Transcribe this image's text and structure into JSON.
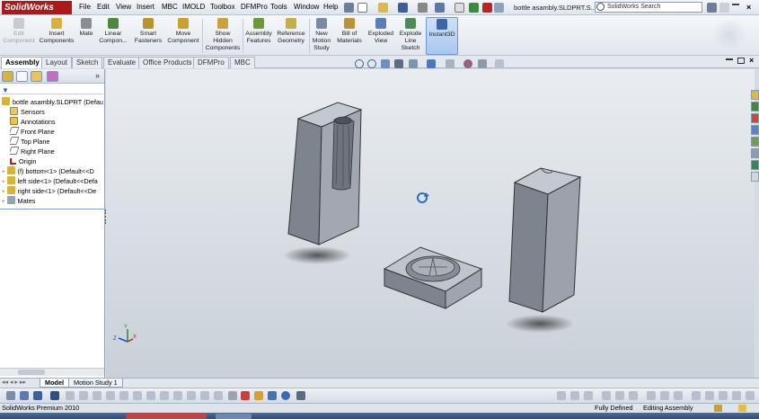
{
  "app": {
    "logo_text": "SolidWorks",
    "doc_title": "bottle asambly.SLDPRT.S...",
    "search_placeholder": "SolidWorks Search"
  },
  "menu": [
    "File",
    "Edit",
    "View",
    "Insert",
    "MBC",
    "IMOLD",
    "Toolbox",
    "DFMPro",
    "Tools",
    "Window",
    "Help"
  ],
  "ribbon": [
    {
      "label": "Edit Component",
      "icon": "edit-component-icon",
      "disabled": true
    },
    {
      "label": "Insert Components",
      "icon": "insert-components-icon"
    },
    {
      "label": "Mate",
      "icon": "mate-icon"
    },
    {
      "label": "Linear Compon...",
      "icon": "linear-pattern-icon"
    },
    {
      "label": "Smart Fasteners",
      "icon": "smart-fasteners-icon"
    },
    {
      "label": "Move Component",
      "icon": "move-component-icon"
    },
    {
      "label": "Show Hidden Components",
      "icon": "show-hidden-icon"
    },
    {
      "label": "Assembly Features",
      "icon": "assembly-features-icon"
    },
    {
      "label": "Reference Geometry",
      "icon": "reference-geometry-icon"
    },
    {
      "label": "New Motion Study",
      "icon": "motion-study-icon"
    },
    {
      "label": "Bill of Materials",
      "icon": "bom-icon"
    },
    {
      "label": "Exploded View",
      "icon": "exploded-view-icon"
    },
    {
      "label": "Explode Line Sketch",
      "icon": "explode-line-icon"
    },
    {
      "label": "Instant3D",
      "icon": "instant3d-icon",
      "active": true
    }
  ],
  "tabs": [
    "Assembly",
    "Layout",
    "Sketch",
    "Evaluate",
    "Office Products",
    "DFMPro",
    "MBC"
  ],
  "tree": [
    {
      "label": "bottle asambly.SLDPRT  (Defau",
      "icon": "assembly-icon",
      "indent": 0
    },
    {
      "label": "Sensors",
      "icon": "sensors-icon",
      "indent": 1
    },
    {
      "label": "Annotations",
      "icon": "annotations-icon",
      "indent": 1
    },
    {
      "label": "Front Plane",
      "icon": "plane-icon",
      "indent": 1
    },
    {
      "label": "Top Plane",
      "icon": "plane-icon",
      "indent": 1
    },
    {
      "label": "Right Plane",
      "icon": "plane-icon",
      "indent": 1
    },
    {
      "label": "Origin",
      "icon": "origin-icon",
      "indent": 1
    },
    {
      "label": "(f) bottom<1> (Default<<D",
      "icon": "part-icon",
      "indent": 1
    },
    {
      "label": "left side<1> (Default<<Defa",
      "icon": "part-icon",
      "indent": 1
    },
    {
      "label": "right side<1> (Default<<De",
      "icon": "part-icon",
      "indent": 1
    },
    {
      "label": "Mates",
      "icon": "mates-icon",
      "indent": 1
    }
  ],
  "bottom_tabs": [
    "Model",
    "Motion Study 1"
  ],
  "status": {
    "left": "SolidWorks Premium 2010",
    "state": "Fully Defined",
    "mode": "Editing Assembly"
  },
  "colors": {
    "accent": "#b01818",
    "viewport_top": "#e9edf1",
    "viewport_bottom": "#c9d0d8",
    "part": "#8a929c"
  }
}
